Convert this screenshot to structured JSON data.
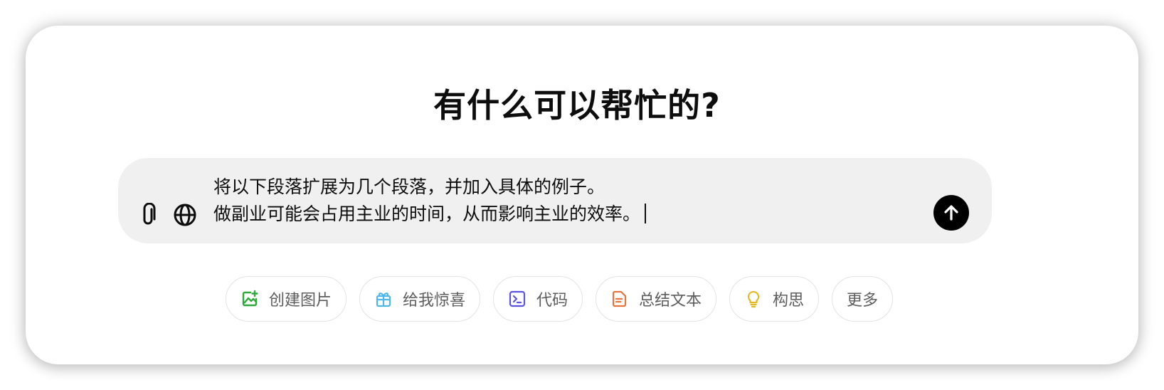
{
  "heading": "有什么可以帮忙的?",
  "composer": {
    "lines": [
      "将以下段落扩展为几个段落，并加入具体的例子。",
      "做副业可能会占用主业的时间，从而影响主业的效率。"
    ],
    "attach_icon": "paperclip-icon",
    "search_icon": "globe-icon",
    "send_icon": "arrow-up-icon"
  },
  "suggestions": [
    {
      "label": "创建图片",
      "icon": "image-create-icon",
      "color": "#2ea83a"
    },
    {
      "label": "给我惊喜",
      "icon": "gift-icon",
      "color": "#4fb6e8"
    },
    {
      "label": "代码",
      "icon": "terminal-icon",
      "color": "#5b52e0"
    },
    {
      "label": "总结文本",
      "icon": "document-icon",
      "color": "#e8743b"
    },
    {
      "label": "构思",
      "icon": "lightbulb-icon",
      "color": "#e2b823"
    },
    {
      "label": "更多",
      "icon": "",
      "color": ""
    }
  ]
}
